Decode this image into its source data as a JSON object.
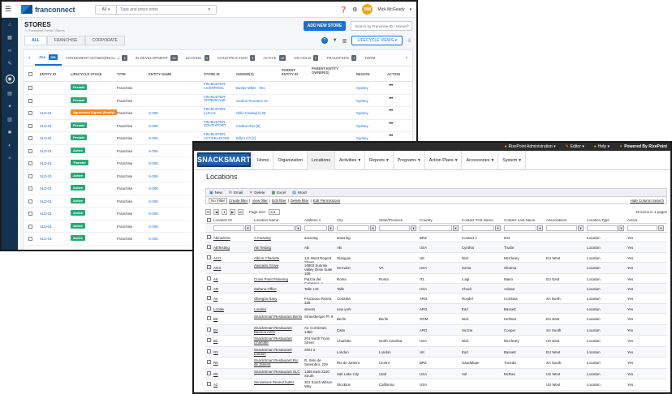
{
  "franconnect": {
    "logo_text": "franconnect",
    "search": {
      "scope": "All",
      "placeholder": "Type and press enter"
    },
    "user": {
      "initials": "MM",
      "name": "Mick McGeady"
    },
    "page_title": "STORES",
    "breadcrumb": "⌂ / Franchise Portal / Stores",
    "add_button": "ADD NEW STORE",
    "filter_placeholder": "Search by Franchise ID / Owner",
    "tabs": [
      "ALL",
      "FRANCHISE",
      "CORPORATE"
    ],
    "lifecycle_button": "LIFECYCLE VIEWS",
    "stages": [
      {
        "label": "ALL",
        "count": "156"
      },
      {
        "label": "AGREEMENT SIGNED(REAL...)",
        "count": "3"
      },
      {
        "label": "IN DEVELOPMENT",
        "count": "25"
      },
      {
        "label": "LEASING",
        "count": "3"
      },
      {
        "label": "CONSTRUCTION",
        "count": "3"
      },
      {
        "label": "ACTIVE",
        "count": "40"
      },
      {
        "label": "ON HOLD",
        "count": "2"
      },
      {
        "label": "TRANSFERS",
        "count": "3"
      },
      {
        "label": "TERM",
        "count": ""
      }
    ],
    "columns": [
      "ENTITY ID",
      "LIFECYCLE STAGE",
      "TYPE",
      "ENTITY NAME",
      "STORE ID",
      "OWNER(S)",
      "PARENT ENTITY ID",
      "PARENT ENTITY OWNER(S)",
      "REGION",
      "ACTION"
    ],
    "rows": [
      {
        "entity_id": "",
        "stage": "Presale",
        "stage_color": "#2aa876",
        "type": "Franchise",
        "name": "",
        "store_id": "FIN-BUSTER-LIVERPOOL",
        "owner": "Buster Miller - 001",
        "region": "Sydney"
      },
      {
        "entity_id": "",
        "stage": "Presale",
        "stage_color": "#2aa876",
        "type": "Franchise",
        "name": "",
        "store_id": "FIN-BUSTER-UPPERCASE",
        "owner": "Carlton Roosters 01",
        "region": "Sydney"
      },
      {
        "entity_id": "SLD-01",
        "stage": "Agreement Signed (Realty)",
        "stage_color": "#f08a24",
        "type": "Franchise",
        "name": "S-006",
        "store_id": "FIN-BUSTER-LUCAS",
        "owner": "Gillis Cowley(s) 05",
        "region": "Sydney"
      },
      {
        "entity_id": "SLD-01",
        "stage": "Presale",
        "stage_color": "#2aa876",
        "type": "Franchise",
        "name": "S-006",
        "store_id": "FIN-BUSTER-SOUTHPORT",
        "owner": "Carlton Roo [5]",
        "region": "Sydney"
      },
      {
        "entity_id": "SLD-01",
        "stage": "Presale",
        "stage_color": "#2aa876",
        "type": "Franchise",
        "name": "S-006",
        "store_id": "FIN-BUSTER-ACT.DRAGONS",
        "owner": "Billy's Ch [2]",
        "region": "Sydney"
      },
      {
        "entity_id": "SLD-01",
        "stage": "Active",
        "stage_color": "#2aa876",
        "type": "Franchise",
        "name": "S-006",
        "store_id": "",
        "owner": "",
        "region": ""
      },
      {
        "entity_id": "SLD-01",
        "stage": "Transfer",
        "stage_color": "#2aa876",
        "type": "Franchise",
        "name": "S-006",
        "store_id": "",
        "owner": "",
        "region": ""
      },
      {
        "entity_id": "SLD-01",
        "stage": "Active",
        "stage_color": "#2aa876",
        "type": "Franchise",
        "name": "S-006",
        "store_id": "",
        "owner": "",
        "region": ""
      },
      {
        "entity_id": "SLD-01",
        "stage": "Active",
        "stage_color": "#2aa876",
        "type": "Franchise",
        "name": "S-006",
        "store_id": "",
        "owner": "",
        "region": ""
      },
      {
        "entity_id": "SLD-01",
        "stage": "Active",
        "stage_color": "#2aa876",
        "type": "Franchise",
        "name": "S-006",
        "store_id": "",
        "owner": "",
        "region": ""
      },
      {
        "entity_id": "SLD-01",
        "stage": "Active",
        "stage_color": "#2aa876",
        "type": "Franchise",
        "name": "S-006",
        "store_id": "",
        "owner": "",
        "region": ""
      },
      {
        "entity_id": "SLD-01",
        "stage": "Active",
        "stage_color": "#2aa876",
        "type": "Franchise",
        "name": "S-006",
        "store_id": "",
        "owner": "",
        "region": ""
      },
      {
        "entity_id": "SLD-01",
        "stage": "Active",
        "stage_color": "#2aa876",
        "type": "Franchise",
        "name": "S-006",
        "store_id": "",
        "owner": "",
        "region": ""
      }
    ]
  },
  "snacksmart": {
    "logo": "SNACKSMART",
    "topbar": {
      "admin": "RizePoint Administration",
      "editor": "Editor",
      "help": "Help",
      "powered": "Powered By RizePoint"
    },
    "menu": [
      "Home",
      "Organization",
      "Locations",
      "Activities",
      "Reports",
      "Programs",
      "Action Plans",
      "Accessories",
      "System"
    ],
    "menu_dropdowns": [
      false,
      false,
      false,
      true,
      true,
      true,
      true,
      true,
      true
    ],
    "page_title": "Locations",
    "toolbar": [
      "New",
      "Email",
      "Delete",
      "Excel",
      "Word"
    ],
    "filters": [
      "No Filter",
      "Create filter",
      "View filter",
      "Edit filter",
      "Delete filter",
      "Edit Permissions"
    ],
    "hide_column_search": "Hide Column Search",
    "pager": {
      "page_size_label": "Page size:",
      "page_size": "50",
      "count": "25 items in 1 pages"
    },
    "columns": [
      "Location ID",
      "Location Name",
      "Address 1",
      "City",
      "State/Province",
      "Country",
      "Contact First Name",
      "Contact Last Name",
      "Associations",
      "Location Type",
      "Active"
    ],
    "rows": [
      {
        "id": "Abinazima",
        "name": "A Amazing",
        "address": "amazing",
        "city": "amazing",
        "state": "",
        "country": "BRZ",
        "first": "Contact 1",
        "last": "test",
        "assoc": "",
        "type": "Location",
        "active": "Yes"
      },
      {
        "id": "ABTesting",
        "name": "AB Testing",
        "address": "AB",
        "city": "AB",
        "state": "",
        "country": "USA",
        "first": "Cynthia",
        "last": "Trudie",
        "assoc": "",
        "type": "Location",
        "active": "Yes"
      },
      {
        "id": "ACG",
        "name": "Albion Charlotte",
        "address": "111 West Regent Street",
        "city": "Glasgow",
        "state": "",
        "country": "UK",
        "first": "Nick",
        "last": "McCleary",
        "assoc": "EU West",
        "type": "Location",
        "active": "Yes"
      },
      {
        "id": "AGS",
        "name": "Avocado Grove",
        "address": "10803 Sunrise Valley Drive Suite 100",
        "city": "Herndon",
        "state": "VA",
        "country": "USA",
        "first": "Sonia",
        "last": "Sharma",
        "assoc": "",
        "type": "Location",
        "active": "Yes"
      },
      {
        "id": "AK",
        "name": "Cross Point Pickering",
        "address": "Piazza del Colosseo, 1",
        "city": "Roma",
        "state": "Roma",
        "country": "ITL",
        "first": "Luigi",
        "last": "Mario",
        "assoc": "EU East",
        "type": "Location",
        "active": "Yes"
      },
      {
        "id": "AR",
        "name": "Sabana Office",
        "address": "Talle 123",
        "city": "Talle",
        "state": "",
        "country": "USA",
        "first": "Chuck",
        "last": "Aviator",
        "assoc": "",
        "type": "Location",
        "active": "Yes"
      },
      {
        "id": "AV",
        "name": "Obregón Navy",
        "address": "Fructuoso Rivera 325",
        "city": "Cordoba",
        "state": "",
        "country": "ARG",
        "first": "Rosdel",
        "last": "Cordova",
        "assoc": "SA North",
        "type": "Location",
        "active": "Yes"
      },
      {
        "id": "Locale",
        "name": "Locales",
        "address": "streets",
        "city": "new york",
        "state": "",
        "country": "ARG",
        "first": "Earl",
        "last": "Bassett",
        "assoc": "",
        "type": "Location",
        "active": "Yes"
      },
      {
        "id": "B6",
        "name": "SnackSmart Restaurant Berlin",
        "address": "Strausberger Pl. 8",
        "city": "Berlin",
        "state": "Berlin",
        "country": "GRM",
        "first": "Nick",
        "last": "Hellmat",
        "assoc": "EU East",
        "type": "Location",
        "active": "Yes"
      },
      {
        "id": "B4",
        "name": "SnackSmart Restaurant Buenos Aires",
        "address": "Av. Corrientes 1350",
        "city": "Cabs",
        "state": "",
        "country": "ARG",
        "first": "Suzzie",
        "last": "Cooper",
        "assoc": "SA South",
        "type": "Location",
        "active": "Yes"
      },
      {
        "id": "B2",
        "name": "SnackSmart Restaurant Charlotte",
        "address": "201 North Tryon Street",
        "city": "Charlotte",
        "state": "North Carolina",
        "country": "USA",
        "first": "Nick",
        "last": "McCleary",
        "assoc": "US East",
        "type": "Location",
        "active": "Yes"
      },
      {
        "id": "R3",
        "name": "SnackSmart Restaurant London",
        "address": "SW1 a",
        "city": "London",
        "state": "London",
        "country": "UK",
        "first": "Earl",
        "last": "Bassett",
        "assoc": "EU West",
        "type": "Location",
        "active": "Yes"
      },
      {
        "id": "R5",
        "name": "SnackSmart Restaurant Rio de Janeiro",
        "address": "R. Sete de Setembro, 229",
        "city": "Rio de Janeiro",
        "state": "Centro",
        "country": "BRZ",
        "first": "Gaudalupe",
        "last": "Tuneda",
        "assoc": "SA South",
        "type": "Location",
        "active": "Yes"
      },
      {
        "id": "R6",
        "name": "SnackSmart Restaurant SLC",
        "address": "1365 East 2100 South",
        "city": "Salt Lake City",
        "state": "Utah",
        "country": "USA",
        "first": "Val",
        "last": "McRae",
        "assoc": "US West",
        "type": "Location",
        "active": "Yes"
      },
      {
        "id": "A2",
        "name": "Sensations Peanut butter",
        "address": "301 South Wilson Way",
        "city": "Stockton",
        "state": "California",
        "country": "USA",
        "first": "",
        "last": "",
        "assoc": "US West",
        "type": "Location",
        "active": "Yes"
      },
      {
        "id": "A7",
        "name": "Superior Grains",
        "address": "10020 Regency Circle",
        "city": "Omaha",
        "state": "Nebraska",
        "country": "USA",
        "first": "",
        "last": "",
        "assoc": "US East",
        "type": "Location",
        "active": "Yes"
      }
    ]
  }
}
